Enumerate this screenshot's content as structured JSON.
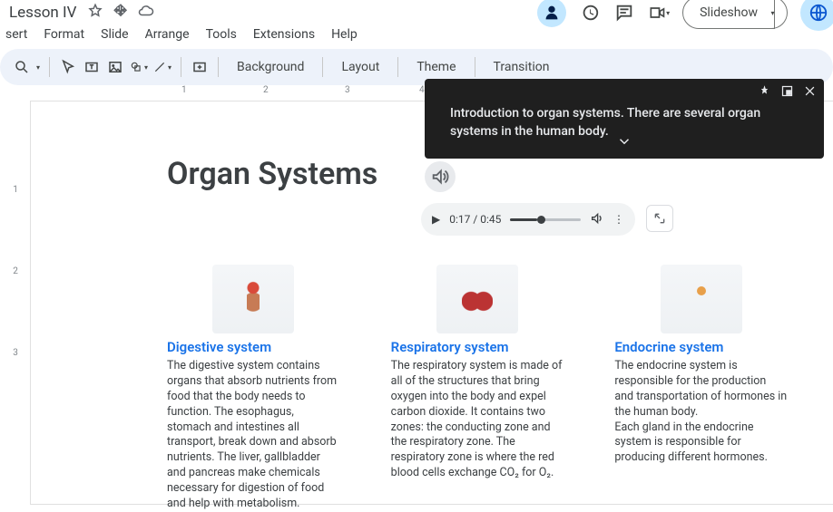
{
  "title": "Lesson IV",
  "menus": [
    "sert",
    "Format",
    "Slide",
    "Arrange",
    "Tools",
    "Extensions",
    "Help"
  ],
  "toolbar": {
    "background": "Background",
    "layout": "Layout",
    "theme": "Theme",
    "transition": "Transition"
  },
  "slideshow_label": "Slideshow",
  "caption": {
    "text": "Introduction to organ systems. There are several organ systems in the human body."
  },
  "slide": {
    "heading": "Organ Systems",
    "audio": {
      "current": "0:17",
      "total": "0:45"
    },
    "columns": [
      {
        "title": "Digestive system",
        "body": "The digestive system contains organs that absorb nutrients from food that the body needs to function. The esophagus, stomach and intestines all transport, break down and absorb nutrients. The liver, gallbladder and pancreas make chemicals necessary for digestion of food and help with metabolism."
      },
      {
        "title": "Respiratory system",
        "body": "The respiratory system is made of all of the structures that bring oxygen into the body and expel carbon dioxide. It contains two zones: the conducting zone and the respiratory zone. The respiratory zone is where the red blood cells exchange CO₂ for O₂."
      },
      {
        "title": "Endocrine system",
        "body": "The endocrine system is responsible for the production and transportation of hormones in the human body.\nEach gland in the endocrine system is responsible for producing different hormones."
      }
    ]
  },
  "hruler": [
    "1",
    "2",
    "3",
    "4"
  ],
  "vruler": [
    "1",
    "2",
    "3"
  ]
}
